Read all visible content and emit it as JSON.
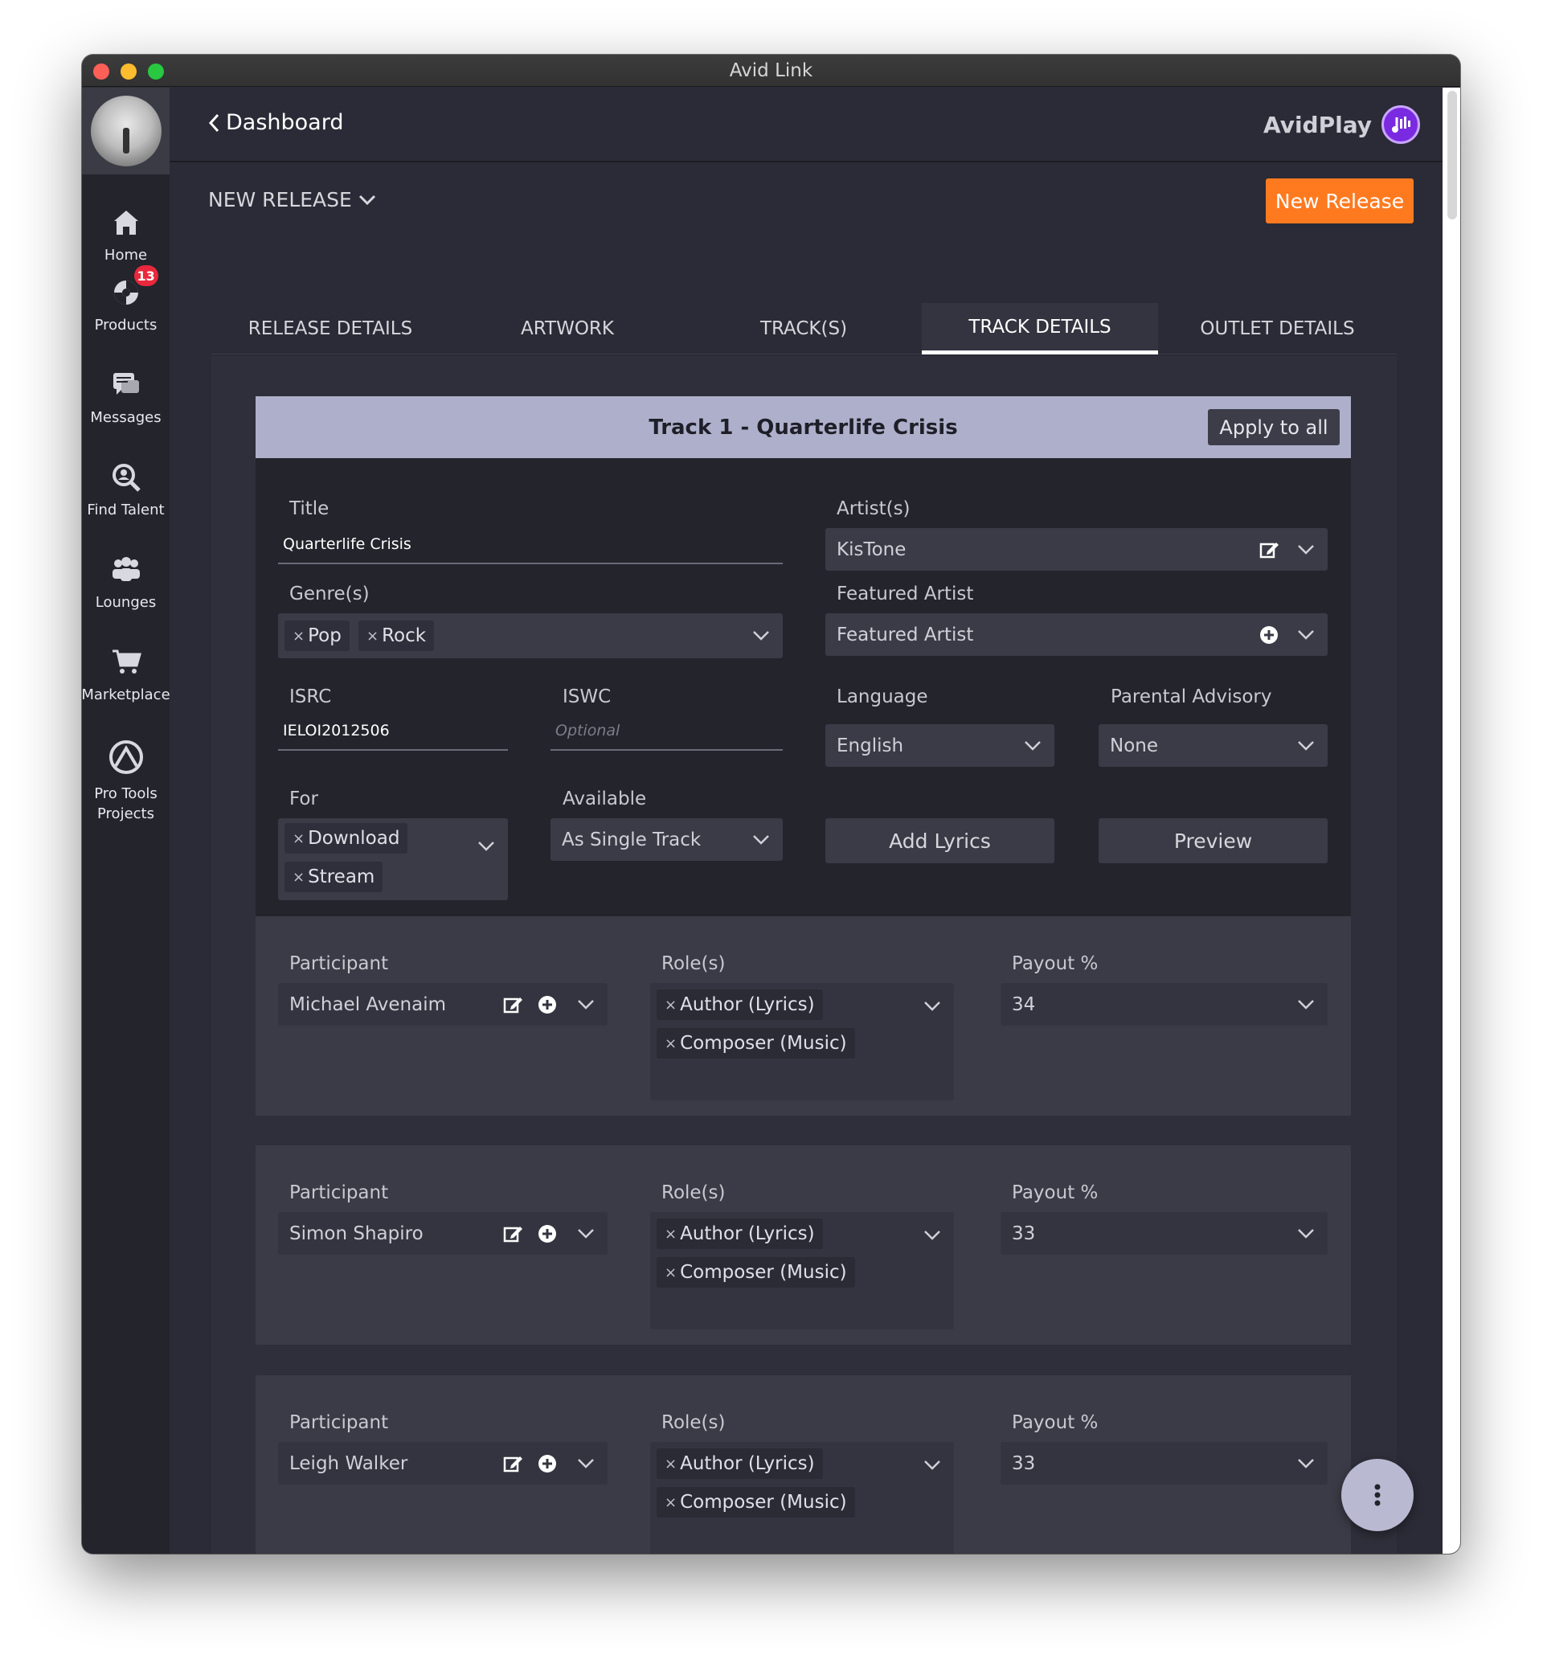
{
  "window": {
    "title": "Avid Link"
  },
  "sidebar": {
    "items": [
      {
        "label": "Home",
        "icon": "home-icon"
      },
      {
        "label": "Products",
        "icon": "products-icon",
        "badge": "13"
      },
      {
        "label": "Messages",
        "icon": "messages-icon"
      },
      {
        "label": "Find Talent",
        "icon": "find-talent-icon"
      },
      {
        "label": "Lounges",
        "icon": "lounges-icon"
      },
      {
        "label": "Marketplace",
        "icon": "cart-icon"
      },
      {
        "label": "Pro Tools\nProjects",
        "icon": "pro-tools-icon"
      }
    ]
  },
  "header": {
    "back_label": "Dashboard",
    "brand": "AvidPlay"
  },
  "subbar": {
    "release_menu": "NEW RELEASE",
    "new_release_button": "New Release"
  },
  "tabs": [
    {
      "label": "RELEASE DETAILS",
      "active": false
    },
    {
      "label": "ARTWORK",
      "active": false
    },
    {
      "label": "TRACK(S)",
      "active": false
    },
    {
      "label": "TRACK DETAILS",
      "active": true
    },
    {
      "label": "OUTLET DETAILS",
      "active": false
    }
  ],
  "track": {
    "header": "Track 1 - Quarterlife Crisis",
    "apply_all": "Apply to all",
    "title_label": "Title",
    "title_value": "Quarterlife Crisis",
    "artists_label": "Artist(s)",
    "artists_value": "KisTone",
    "genres_label": "Genre(s)",
    "genres": [
      "Pop",
      "Rock"
    ],
    "featured_label": "Featured Artist",
    "featured_placeholder": "Featured Artist",
    "isrc_label": "ISRC",
    "isrc_value": "IELOI2012506",
    "iswc_label": "ISWC",
    "iswc_placeholder": "Optional",
    "language_label": "Language",
    "language_value": "English",
    "advisory_label": "Parental Advisory",
    "advisory_value": "None",
    "for_label": "For",
    "for_values": [
      "Download",
      "Stream"
    ],
    "available_label": "Available",
    "available_value": "As Single Track",
    "add_lyrics": "Add Lyrics",
    "preview": "Preview"
  },
  "participants_labels": {
    "participant": "Participant",
    "roles": "Role(s)",
    "payout": "Payout %"
  },
  "participants": [
    {
      "name": "Michael Avenaim",
      "roles": [
        "Author (Lyrics)",
        "Composer (Music)"
      ],
      "payout": "34"
    },
    {
      "name": "Simon Shapiro",
      "roles": [
        "Author (Lyrics)",
        "Composer (Music)"
      ],
      "payout": "33"
    },
    {
      "name": "Leigh Walker",
      "roles": [
        "Author (Lyrics)",
        "Composer (Music)"
      ],
      "payout": "33"
    }
  ],
  "colors": {
    "accent": "#ff7a1f",
    "card_header": "#aeb0cb",
    "brand_purple": "#7a2ae0",
    "badge": "#e8283c"
  }
}
